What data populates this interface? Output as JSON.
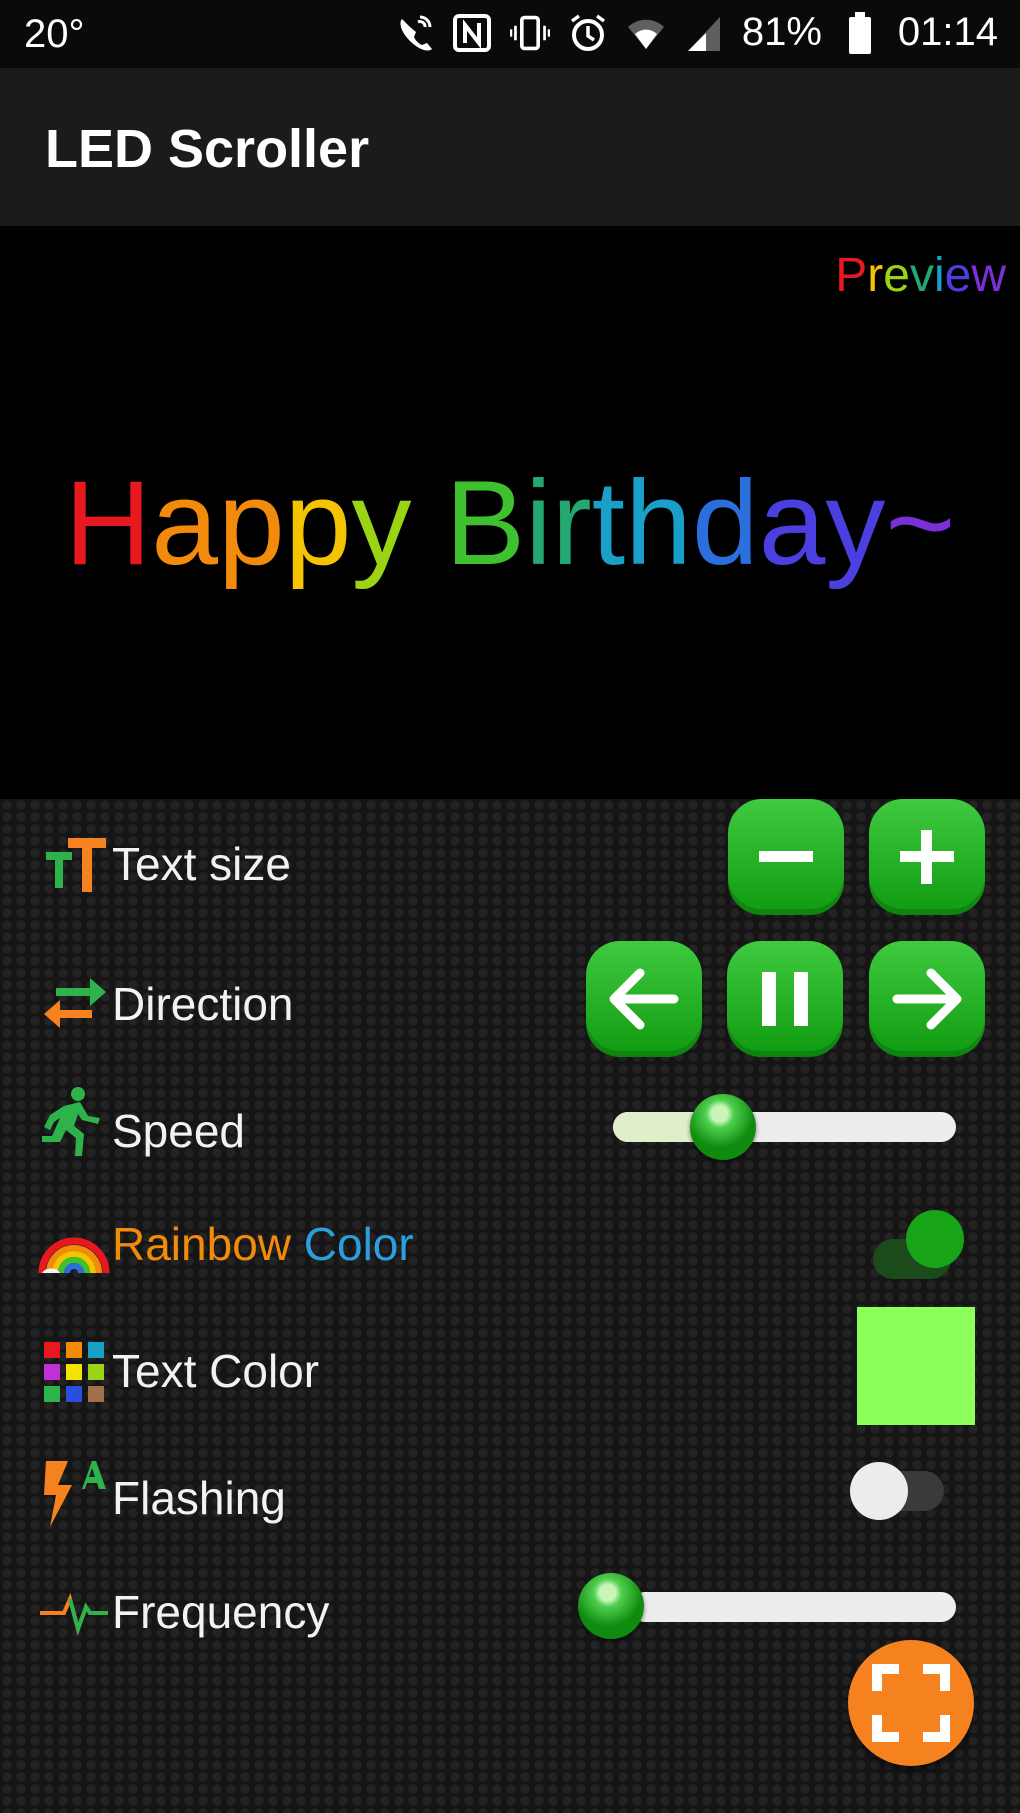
{
  "status_bar": {
    "temperature": "20°",
    "battery_percent": "81%",
    "time": "01:14",
    "icons": [
      "wifi-calling-icon",
      "nfc-icon",
      "vibrate-icon",
      "alarm-icon",
      "wifi-icon",
      "signal-icon",
      "battery-icon"
    ]
  },
  "app_bar": {
    "title": "LED Scroller"
  },
  "preview": {
    "label": "Preview",
    "text": "Happy Birthday~",
    "rainbow": true
  },
  "controls": {
    "text_size": {
      "label": "Text size",
      "icon": "text-size-icon",
      "buttons": [
        "decrease",
        "increase"
      ]
    },
    "direction": {
      "label": "Direction",
      "icon": "direction-arrows-icon",
      "buttons": [
        "left",
        "pause",
        "right"
      ]
    },
    "speed": {
      "label": "Speed",
      "icon": "running-person-icon",
      "value_fraction": 0.32
    },
    "rainbow_color": {
      "label_part1": "Rainbow",
      "label_part2": "Color",
      "icon": "rainbow-icon",
      "enabled": true
    },
    "text_color": {
      "label": "Text Color",
      "icon": "color-grid-icon",
      "color": "#8cff5a"
    },
    "flashing": {
      "label": "Flashing",
      "icon": "flash-text-icon",
      "enabled": false
    },
    "frequency": {
      "label": "Frequency",
      "icon": "pulse-icon",
      "value_fraction": 0.0
    }
  },
  "fab": {
    "icon": "fullscreen-icon"
  },
  "colors": {
    "button_green": "#1fae1f",
    "fab_orange": "#f5821f",
    "rainbow": [
      "#e8191e",
      "#f28a0b",
      "#f5c400",
      "#9ad414",
      "#3fc12f",
      "#23a872",
      "#1aa0c8",
      "#2b6fdd",
      "#4b3fe0",
      "#7a2fd8"
    ]
  }
}
